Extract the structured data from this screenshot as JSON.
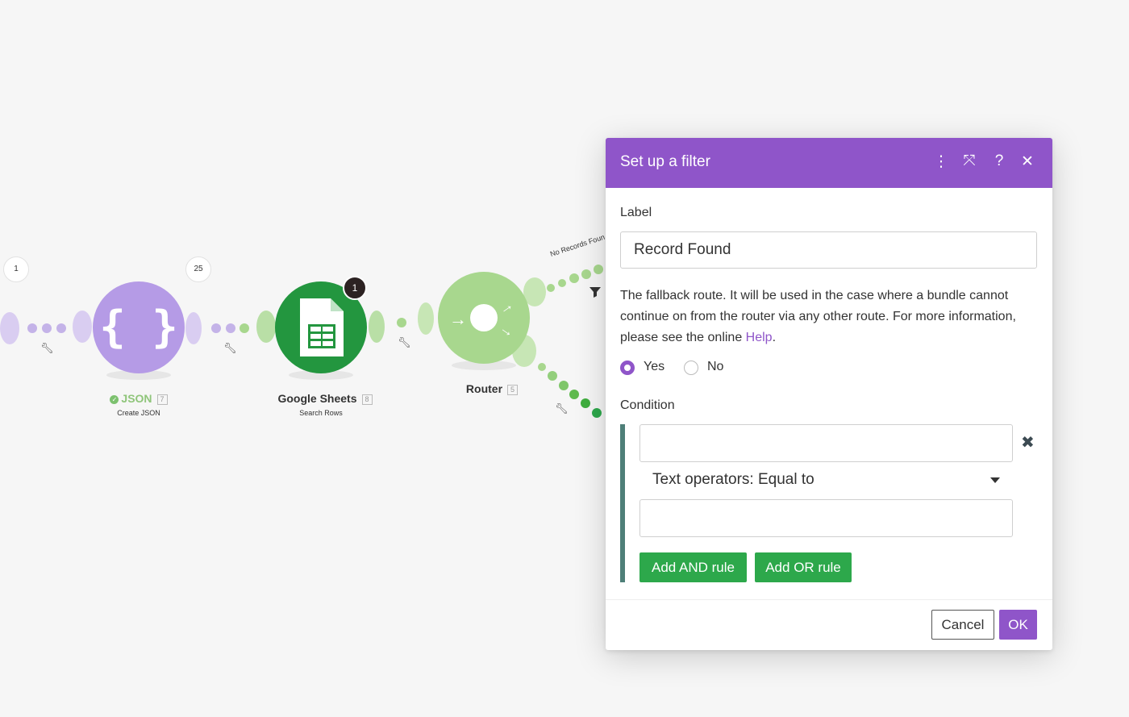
{
  "scenario": {
    "counters": {
      "left": "1",
      "json_output": "25"
    },
    "nodes": {
      "json": {
        "title": "JSON",
        "id": "7",
        "subtitle": "Create JSON",
        "color": "#b59be6"
      },
      "sheets": {
        "title": "Google Sheets",
        "id": "8",
        "subtitle": "Search Rows",
        "operations": "1",
        "color": "#23963f"
      },
      "router": {
        "title": "Router",
        "id": "5",
        "color": "#a8d78e"
      }
    },
    "routes": {
      "top_label": "No Records Foun"
    }
  },
  "dialog": {
    "title": "Set up a filter",
    "header_icons": [
      "more-vertical-icon",
      "expand-icon",
      "help-icon",
      "close-icon"
    ],
    "header_glyphs": {
      "more": "⋮",
      "expand": "⤧",
      "help": "?",
      "close": "✕"
    },
    "label_heading": "Label",
    "label_value": "Record Found",
    "fallback_text": "The fallback route. It will be used in the case where a bundle cannot continue on from the router via any other route. For more information, please see the online ",
    "help_link": "Help",
    "fallback_text_end": ".",
    "fallback_options": {
      "yes": "Yes",
      "no": "No",
      "selected": "Yes"
    },
    "condition_heading": "Condition",
    "condition": {
      "first_operand": "",
      "operator": "Text operators: Equal to",
      "second_operand": "",
      "remove_glyph": "✖"
    },
    "add_and_rule": "Add AND rule",
    "add_or_rule": "Add OR rule",
    "cancel": "Cancel",
    "ok": "OK",
    "accent_color": "#8f55c9",
    "button_green": "#2da84b"
  }
}
